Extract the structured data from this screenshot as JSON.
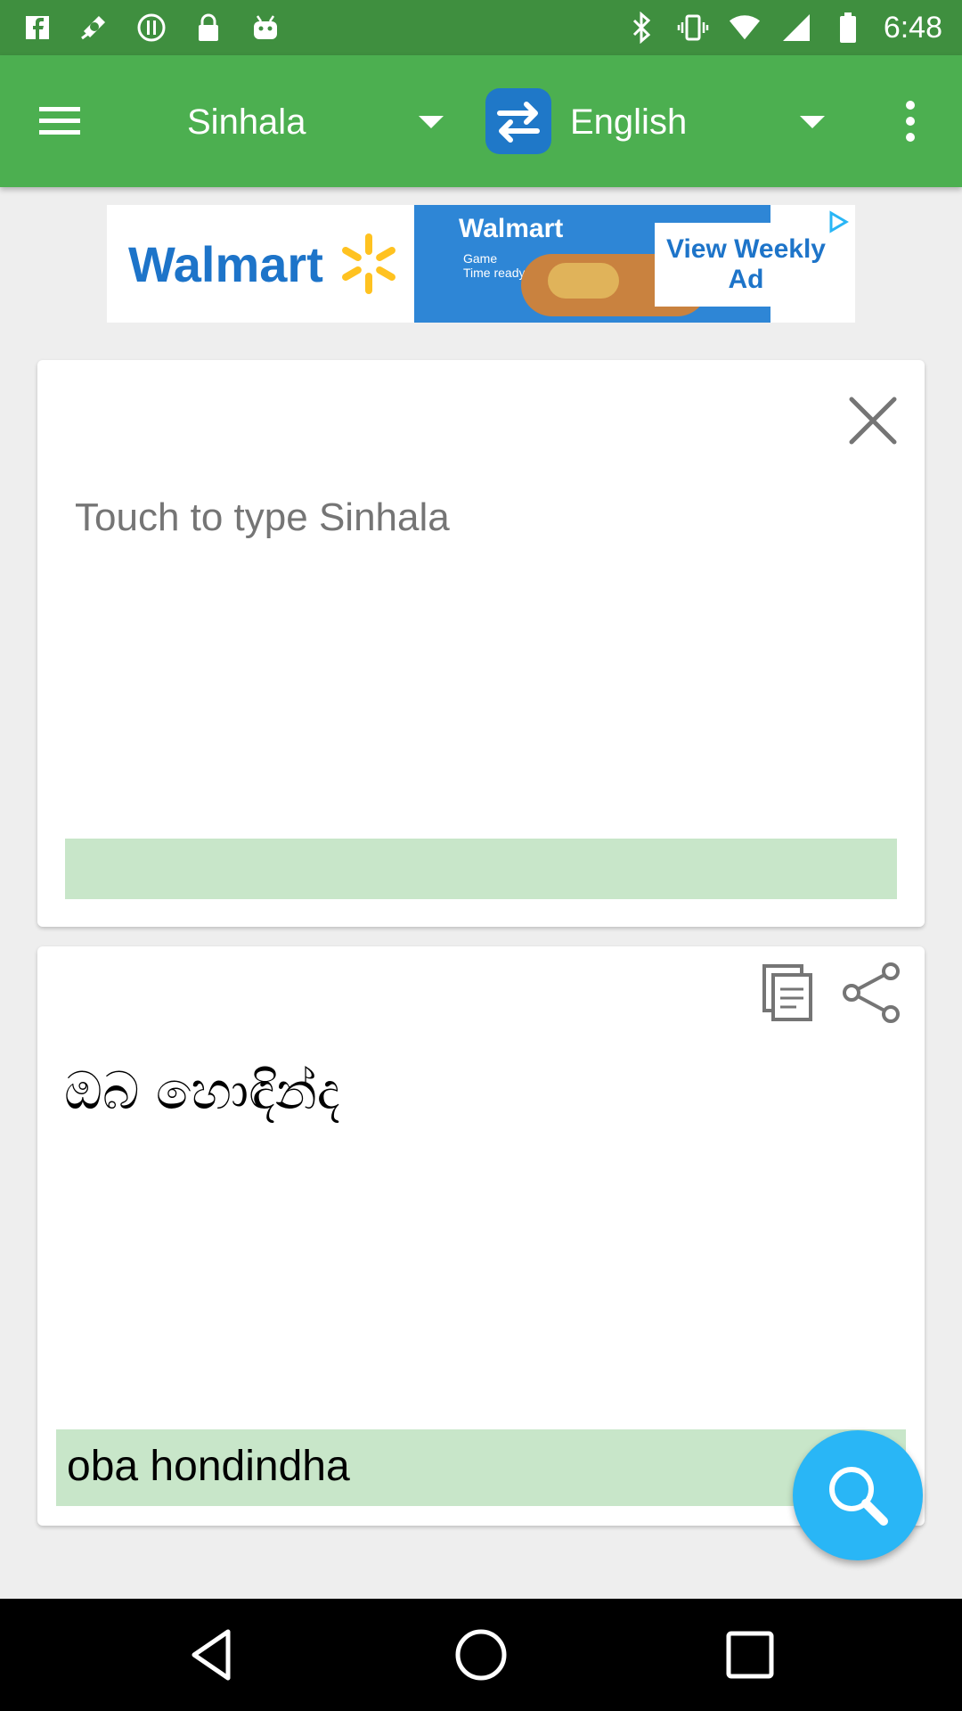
{
  "status_bar": {
    "time": "6:48",
    "icons_left": [
      "facebook-icon",
      "satellite-fake-gps-icon",
      "alert-circle-icon",
      "lock-icon",
      "android-icon"
    ],
    "icons_right": [
      "bluetooth-icon",
      "vibrate-icon",
      "wifi-icon",
      "signal-icon",
      "battery-icon"
    ]
  },
  "toolbar": {
    "source_language": "Sinhala",
    "target_language": "English",
    "bg_color": "#4caf50"
  },
  "ad": {
    "brand": "Walmart",
    "middle_brand": "Walmart",
    "middle_sub": "Game Time ready",
    "cta": "View Weekly Ad"
  },
  "input_card": {
    "placeholder": "Touch to type Sinhala",
    "bar_color": "#c8e6c9"
  },
  "output_card": {
    "translation": "ඔබ හොඳින්ද",
    "transliteration": "oba  hondindha"
  },
  "fab": {
    "icon": "search-icon",
    "color": "#29b6f6"
  }
}
